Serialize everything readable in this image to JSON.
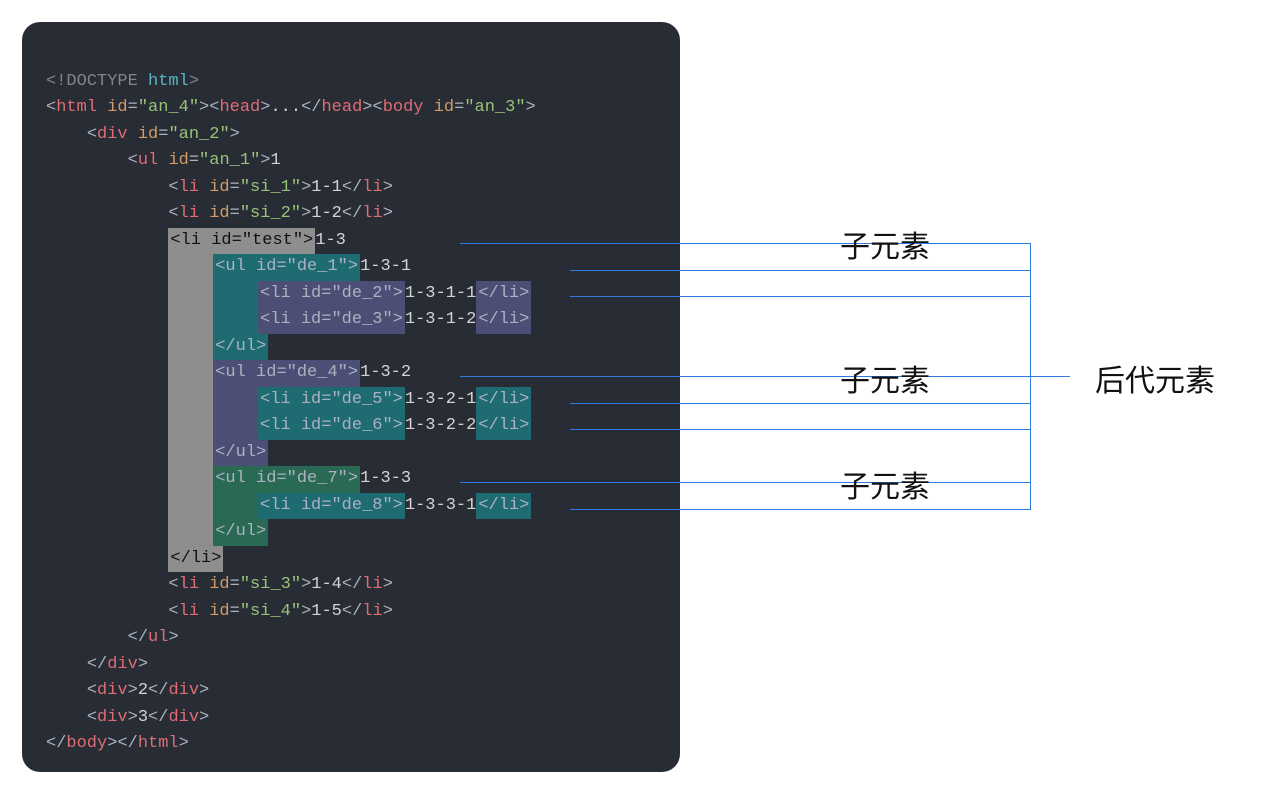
{
  "labels": {
    "child1": "子元素",
    "child2": "子元素",
    "child3": "子元素",
    "descendant": "后代元素"
  },
  "code_tokens": {
    "doctype": "<!DOCTYPE ",
    "html_kw": "html",
    "close_angle": ">",
    "html_open": "<html ",
    "id_attr": "id",
    "eq": "=",
    "q": "\"",
    "an4": "an_4",
    "head_open": "><head>",
    "dots": "...",
    "head_close": "</head>",
    "body_open": "<body ",
    "an3": "an_3",
    "div_open": "<div ",
    "an2": "an_2",
    "ul_open": "<ul ",
    "an1": "an_1",
    "one": "1",
    "li_open": "<li ",
    "si1": "si_1",
    "t11": "1-1",
    "li_close": "</li>",
    "si2": "si_2",
    "t12": "1-2",
    "test": "test",
    "t13": "1-3",
    "de1": "de_1",
    "t131": "1-3-1",
    "de2": "de_2",
    "t1311": "1-3-1-1",
    "de3": "de_3",
    "t1312": "1-3-1-2",
    "ul_close": "</ul>",
    "de4": "de_4",
    "t132": "1-3-2",
    "de5": "de_5",
    "t1321": "1-3-2-1",
    "de6": "de_6",
    "t1322": "1-3-2-2",
    "de7": "de_7",
    "t133": "1-3-3",
    "de8": "de_8",
    "t1331": "1-3-3-1",
    "si3": "si_3",
    "t14": "1-4",
    "si4": "si_4",
    "t15": "1-5",
    "div_close": "</div>",
    "div2": "<div>",
    "two": "2",
    "three": "3",
    "body_close": "</body>",
    "html_close": "</html>"
  }
}
